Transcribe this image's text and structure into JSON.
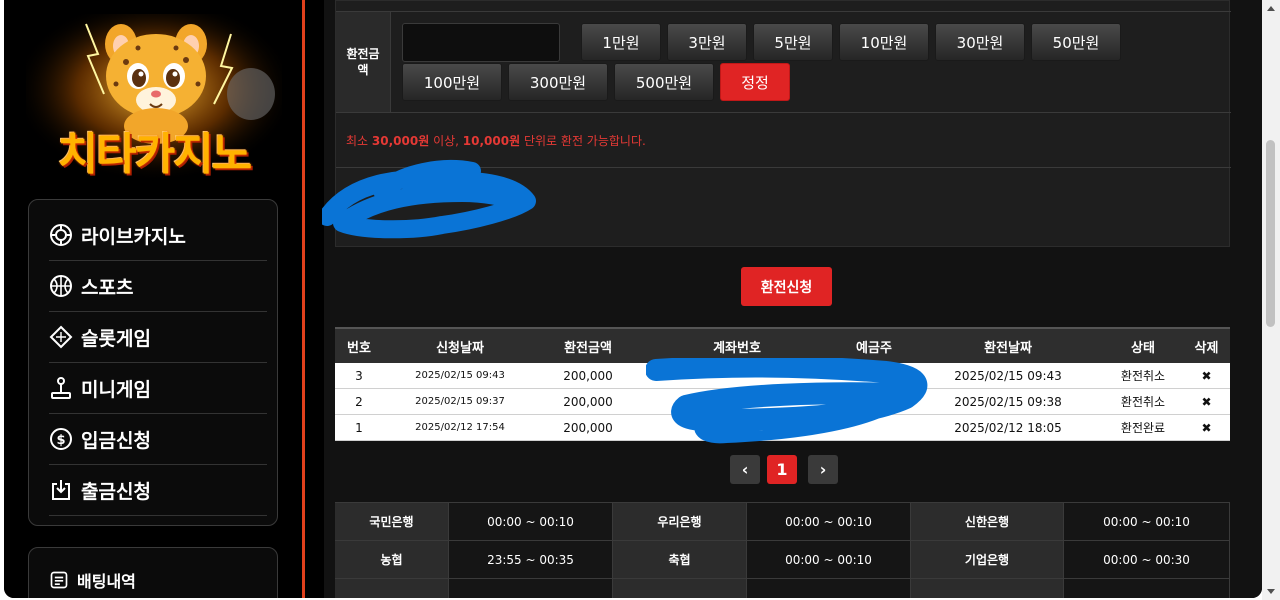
{
  "logo": {
    "text": "치타카지노",
    "mascot": "cheetah-mascot"
  },
  "sidebar": {
    "items": [
      {
        "label": "라이브카지노",
        "icon": "poker-chip-icon"
      },
      {
        "label": "스포츠",
        "icon": "basketball-icon"
      },
      {
        "label": "슬롯게임",
        "icon": "diamond-icon"
      },
      {
        "label": "미니게임",
        "icon": "joystick-icon"
      },
      {
        "label": "입금신청",
        "icon": "dollar-coin-icon"
      },
      {
        "label": "출금신청",
        "icon": "withdraw-icon"
      }
    ],
    "secondary": [
      {
        "label": "배팅내역",
        "icon": "betting-history-icon"
      }
    ]
  },
  "form": {
    "amount_label": "환전금액",
    "amount_value": "",
    "amount_buttons": [
      "1만원",
      "3만원",
      "5만원",
      "10만원",
      "30만원",
      "50만원",
      "100만원",
      "300만원",
      "500만원"
    ],
    "reset_label": "정정",
    "notice": {
      "pre": "최소 ",
      "min": "30,000원",
      "mid": " 이상, ",
      "unit": "10,000원",
      "post": "  단위로 환전 가능합니다."
    },
    "submit_label": "환전신청"
  },
  "history": {
    "headers": [
      "번호",
      "신청날짜",
      "환전금액",
      "계좌번호",
      "예금주",
      "환전날짜",
      "상태",
      "삭제"
    ],
    "rows": [
      {
        "no": "3",
        "requested": "2025/02/15 09:43",
        "amount": "200,000",
        "account": "",
        "holder": "",
        "processed": "2025/02/15 09:43",
        "status": "환전취소",
        "delete": "✖"
      },
      {
        "no": "2",
        "requested": "2025/02/15 09:37",
        "amount": "200,000",
        "account": "",
        "holder": "",
        "processed": "2025/02/15 09:38",
        "status": "환전취소",
        "delete": "✖"
      },
      {
        "no": "1",
        "requested": "2025/02/12 17:54",
        "amount": "200,000",
        "account": "",
        "holder": "",
        "processed": "2025/02/12 18:05",
        "status": "환전완료",
        "delete": "✖"
      }
    ]
  },
  "pagination": {
    "prev": "‹",
    "current": "1",
    "next": "›"
  },
  "banks": [
    [
      {
        "name": "국민은행",
        "time": "00:00 ~ 00:10"
      },
      {
        "name": "우리은행",
        "time": "00:00 ~ 00:10"
      },
      {
        "name": "신한은행",
        "time": "00:00 ~ 00:10"
      }
    ],
    [
      {
        "name": "농협",
        "time": "23:55 ~ 00:35"
      },
      {
        "name": "축협",
        "time": "00:00 ~ 00:10"
      },
      {
        "name": "기업은행",
        "time": "00:00 ~ 00:30"
      }
    ]
  ],
  "colors": {
    "accent": "#e02424",
    "divider": "#e0401c",
    "notice": "#e53935",
    "scribble": "#0a74d6"
  }
}
